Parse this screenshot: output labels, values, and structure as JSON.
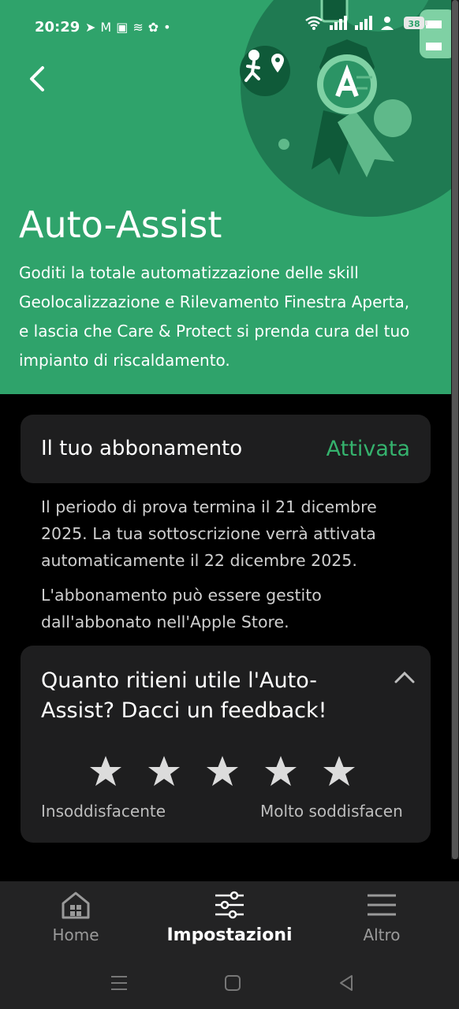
{
  "status_bar": {
    "time": "20:29",
    "battery": "38"
  },
  "hero": {
    "title": "Auto-Assist",
    "description": "Goditi la totale automatizzazione delle skill Geolocalizzazione e Rilevamento Finestra Aperta, e lascia che Care & Protect si prenda cura del tuo impianto di riscaldamento."
  },
  "subscription": {
    "label": "Il tuo abbonamento",
    "status": "Attivata",
    "status_color": "#35b26d",
    "info_1": "Il periodo di prova termina il 21 dicembre 2025. La tua sottoscrizione verrà attivata automaticamente il 22 dicembre 2025.",
    "info_2": "L'abbonamento può essere gestito dall'abbonato nell'Apple Store."
  },
  "feedback": {
    "question": "Quanto ritieni utile l'Auto-Assist? Dacci un feedback!",
    "rating_low_label": "Insoddisfacente",
    "rating_high_label": "Molto soddisfacen",
    "stars_total": 5,
    "stars_selected": 0
  },
  "bottom_nav": {
    "items": [
      {
        "label": "Home",
        "icon": "home-icon",
        "active": false
      },
      {
        "label": "Impostazioni",
        "icon": "sliders-icon",
        "active": true
      },
      {
        "label": "Altro",
        "icon": "menu-icon",
        "active": false
      }
    ]
  },
  "colors": {
    "hero_bg": "#2fa36b",
    "accent": "#35b26d",
    "card_bg": "#1e1e1f"
  }
}
